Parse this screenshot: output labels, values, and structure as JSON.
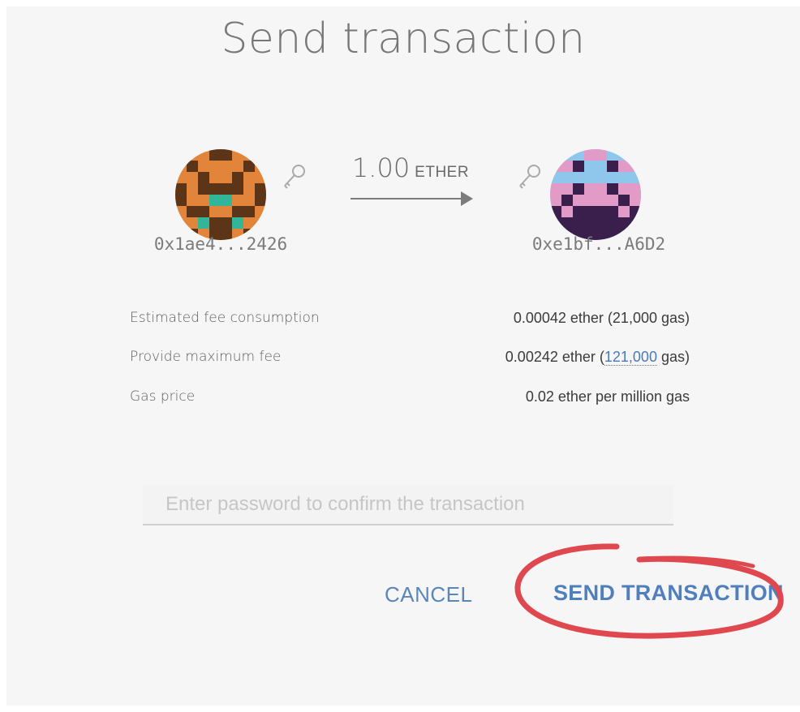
{
  "dialog": {
    "title": "Send transaction"
  },
  "sender": {
    "address": "0x1ae4...2426",
    "icon": "key-icon"
  },
  "recipient": {
    "address": "0xe1bf...A6D2",
    "icon": "key-icon"
  },
  "transfer": {
    "amount": "1.00",
    "unit": "ETHER"
  },
  "fees": {
    "estimated": {
      "label": "Estimated fee consumption",
      "value": "0.00042 ether (21,000 gas)"
    },
    "maximum": {
      "label": "Provide maximum fee",
      "value_prefix": "0.00242 ether (",
      "gas_link": "121,000",
      "value_suffix": " gas)"
    },
    "gas_price": {
      "label": "Gas price",
      "value": "0.02 ether per million gas"
    }
  },
  "password": {
    "placeholder": "Enter password to confirm the transaction",
    "value": ""
  },
  "actions": {
    "cancel_label": "CANCEL",
    "send_label": "SEND TRANSACTION"
  },
  "colors": {
    "accent": "#4f7fbd",
    "annotation": "#e0484f",
    "panel_bg": "#f6f6f6"
  }
}
